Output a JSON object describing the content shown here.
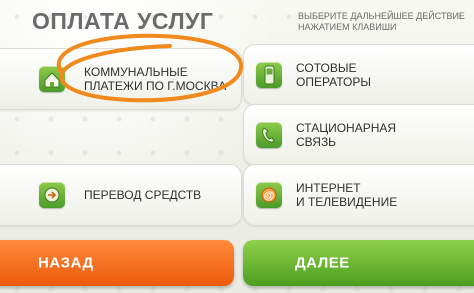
{
  "header": {
    "title": "ОПЛАТА УСЛУГ",
    "hint_line1": "ВЫБЕРИТЕ ДАЛЬНЕЙШЕЕ ДЕЙСТВИЕ",
    "hint_line2": "НАЖАТИЕМ КЛАВИШИ"
  },
  "options": {
    "communal": {
      "line1": "КОММУНАЛЬНЫЕ",
      "line2": "ПЛАТЕЖИ ПО г.МОСКВА",
      "icon": "house-icon"
    },
    "mobile": {
      "line1": "СОТОВЫЕ",
      "line2": "ОПЕРАТОРЫ",
      "icon": "mobile-phone-icon"
    },
    "landline": {
      "line1": "СТАЦИОНАРНАЯ",
      "line2": "СВЯЗЬ",
      "icon": "landline-phone-icon"
    },
    "transfer": {
      "line1": "ПЕРЕВОД СРЕДСТВ",
      "icon": "money-transfer-icon"
    },
    "internet": {
      "line1": "ИНТЕРНЕТ",
      "line2": "И ТЕЛЕВИДЕНИЕ",
      "icon": "at-sign-icon"
    }
  },
  "buttons": {
    "back": "НАЗАД",
    "next": "ДАЛЕЕ"
  },
  "colors": {
    "orange": "#ec5a0a",
    "green": "#4c9d1f",
    "highlight_circle": "#f08a1c"
  }
}
